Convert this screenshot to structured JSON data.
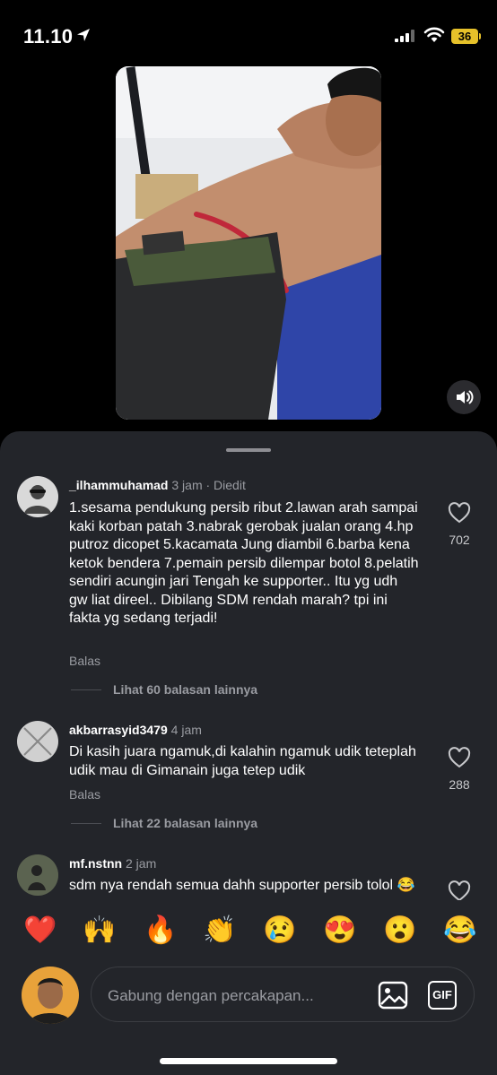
{
  "status": {
    "time": "11.10",
    "battery": "36"
  },
  "comments": [
    {
      "username": "_ilhammuhamad",
      "meta": "3 jam · Diedit",
      "text": "1.sesama pendukung persib ribut 2.lawan arah sampai kaki korban patah 3.nabrak gerobak jualan orang 4.hp putroz dicopet 5.kacamata Jung diambil 6.barba kena ketok bendera 7.pemain persib dilempar botol 8.pelatih sendiri acungin jari Tengah ke supporter.. Itu yg udh gw liat direel.. Dibilang SDM rendah marah? tpi ini fakta yg sedang terjadi!",
      "reply": "Balas",
      "more_replies": "Lihat 60 balasan lainnya",
      "likes": "702"
    },
    {
      "username": "akbarrasyid3479",
      "meta": "4 jam",
      "text": "Di kasih juara ngamuk,di kalahin ngamuk udik teteplah udik mau di Gimanain juga tetep udik",
      "reply": "Balas",
      "more_replies": "Lihat 22 balasan lainnya",
      "likes": "288"
    },
    {
      "username": "mf.nstnn",
      "meta": "2 jam",
      "text": "sdm nya rendah semua dahh supporter persib tolol 😂"
    }
  ],
  "reactions": [
    "❤️",
    "🙌",
    "🔥",
    "👏",
    "😢",
    "😍",
    "😮",
    "😂"
  ],
  "composer": {
    "placeholder": "Gabung dengan percakapan...",
    "gif_label": "GIF"
  },
  "colors": {
    "sheet": "#23252a",
    "muted": "#9a9ca2",
    "battery": "#e6c12a"
  }
}
